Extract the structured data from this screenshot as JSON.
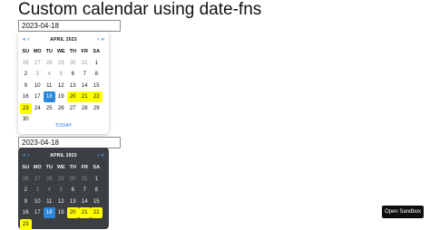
{
  "page": {
    "title": "Custom calendar using date-fns"
  },
  "input1": {
    "value": "2023-04-18"
  },
  "input2": {
    "value": "2023-04-18"
  },
  "calendar_light": {
    "month": "APRIL 2023",
    "prev": "« ‹",
    "next": "› »",
    "weekdays": [
      "SU",
      "MO",
      "TU",
      "WE",
      "TH",
      "FR",
      "SA"
    ],
    "weeks": [
      [
        "26",
        "27",
        "28",
        "29",
        "30",
        "31",
        "1"
      ],
      [
        "2",
        "3",
        "4",
        "5",
        "6",
        "7",
        "8"
      ],
      [
        "9",
        "10",
        "11",
        "12",
        "13",
        "14",
        "15"
      ],
      [
        "16",
        "17",
        "18",
        "19",
        "20",
        "21",
        "22"
      ],
      [
        "23",
        "24",
        "25",
        "26",
        "27",
        "28",
        "29"
      ],
      [
        "30",
        "",
        "",
        "",
        "",
        "",
        ""
      ]
    ],
    "today_label": "TODAY",
    "selected": "18",
    "highlighted": [
      "20",
      "21",
      "22",
      "23"
    ]
  },
  "calendar_dark": {
    "month": "APRIL 2023",
    "prev": "« ‹",
    "next": "› »",
    "weekdays": [
      "SU",
      "MO",
      "TU",
      "WE",
      "TH",
      "FR",
      "SA"
    ],
    "weeks": [
      [
        "26",
        "27",
        "28",
        "29",
        "30",
        "31",
        "1"
      ],
      [
        "2",
        "3",
        "4",
        "5",
        "6",
        "7",
        "8"
      ],
      [
        "9",
        "10",
        "11",
        "12",
        "13",
        "14",
        "15"
      ],
      [
        "16",
        "17",
        "18",
        "19",
        "20",
        "21",
        "22"
      ],
      [
        "23",
        "",
        "",
        "",
        "",
        "",
        ""
      ]
    ],
    "selected": "18",
    "highlighted": [
      "20",
      "21",
      "22",
      "23"
    ]
  },
  "sandbox_button": {
    "label": "Open Sandbox"
  },
  "colors": {
    "selected": "#2c86d9",
    "highlight": "#ffff00",
    "dark_bg": "#3b3f44",
    "accent": "#2a7ae2"
  }
}
